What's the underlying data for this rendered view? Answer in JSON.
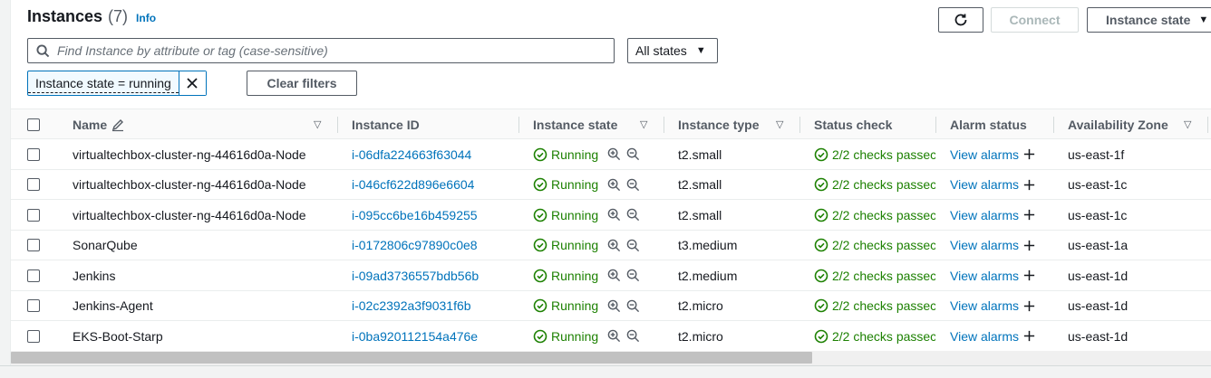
{
  "header": {
    "title": "Instances",
    "count": "(7)",
    "info": "Info"
  },
  "toolbar": {
    "connect": "Connect",
    "instance_state": "Instance state"
  },
  "search": {
    "placeholder": "Find Instance by attribute or tag (case-sensitive)",
    "value": ""
  },
  "states_filter": {
    "selected": "All states"
  },
  "filter_token": {
    "label": "Instance state = running"
  },
  "clear_filters": "Clear filters",
  "columns": {
    "name": "Name",
    "instance_id": "Instance ID",
    "instance_state": "Instance state",
    "instance_type": "Instance type",
    "status_check": "Status check",
    "alarm_status": "Alarm status",
    "availability_zone": "Availability Zone"
  },
  "rows": [
    {
      "name": "virtualtechbox-cluster-ng-44616d0a-Node",
      "id": "i-06dfa224663f63044",
      "state": "Running",
      "type": "t2.small",
      "status": "2/2 checks passec",
      "alarm": "View alarms",
      "az": "us-east-1f"
    },
    {
      "name": "virtualtechbox-cluster-ng-44616d0a-Node",
      "id": "i-046cf622d896e6604",
      "state": "Running",
      "type": "t2.small",
      "status": "2/2 checks passec",
      "alarm": "View alarms",
      "az": "us-east-1c"
    },
    {
      "name": "virtualtechbox-cluster-ng-44616d0a-Node",
      "id": "i-095cc6be16b459255",
      "state": "Running",
      "type": "t2.small",
      "status": "2/2 checks passec",
      "alarm": "View alarms",
      "az": "us-east-1c"
    },
    {
      "name": "SonarQube",
      "id": "i-0172806c97890c0e8",
      "state": "Running",
      "type": "t3.medium",
      "status": "2/2 checks passec",
      "alarm": "View alarms",
      "az": "us-east-1a"
    },
    {
      "name": "Jenkins",
      "id": "i-09ad3736557bdb56b",
      "state": "Running",
      "type": "t2.medium",
      "status": "2/2 checks passec",
      "alarm": "View alarms",
      "az": "us-east-1d"
    },
    {
      "name": "Jenkins-Agent",
      "id": "i-02c2392a3f9031f6b",
      "state": "Running",
      "type": "t2.micro",
      "status": "2/2 checks passec",
      "alarm": "View alarms",
      "az": "us-east-1d"
    },
    {
      "name": "EKS-Boot-Starp",
      "id": "i-0ba920112154a476e",
      "state": "Running",
      "type": "t2.micro",
      "status": "2/2 checks passec",
      "alarm": "View alarms",
      "az": "us-east-1d"
    }
  ],
  "colors": {
    "link": "#0073bb",
    "success": "#1d8102",
    "border": "#545b64"
  }
}
